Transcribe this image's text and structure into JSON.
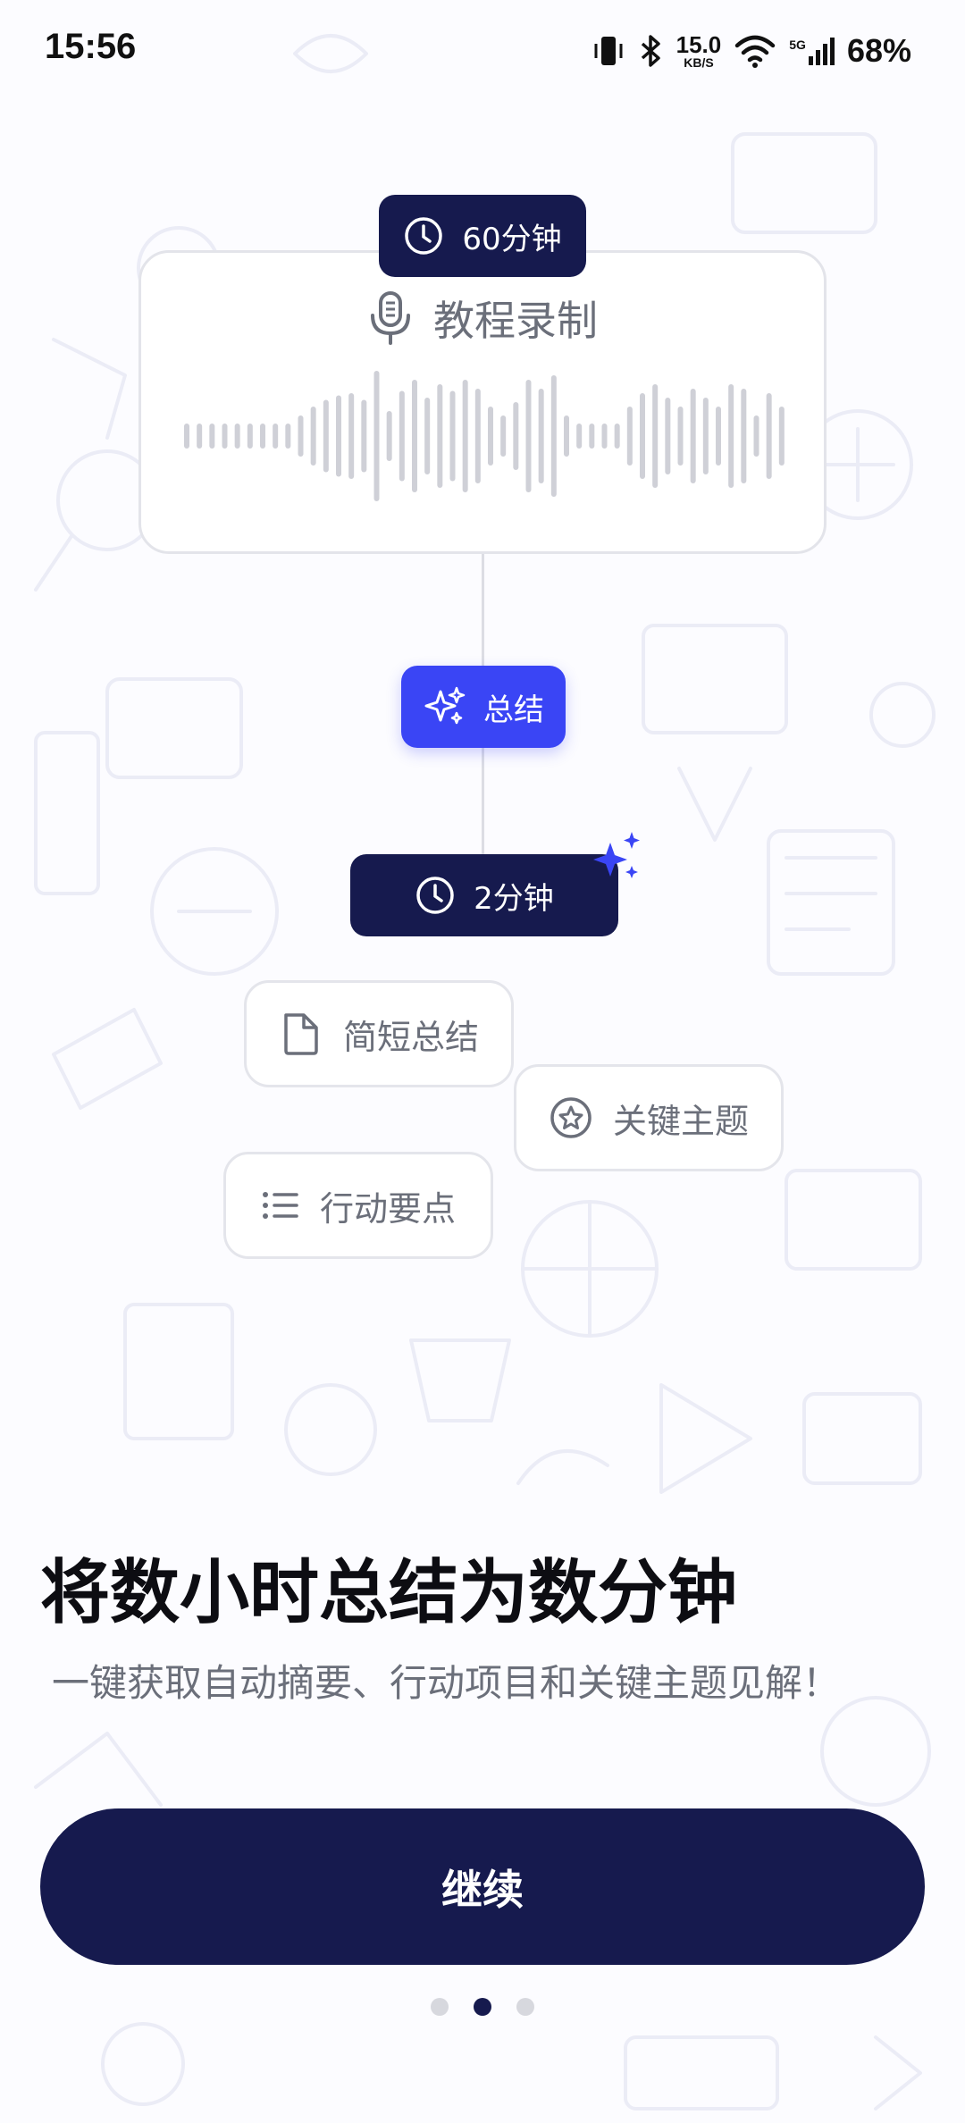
{
  "status_bar": {
    "time": "15:56",
    "net_speed_value": "15.0",
    "net_speed_unit": "KB/S",
    "network_type": "5G",
    "battery": "68%",
    "icons": [
      "vibrate-icon",
      "bluetooth-icon",
      "wifi-icon",
      "cellular-signal-icon"
    ]
  },
  "recording_card": {
    "duration_label": "60分钟",
    "title": "教程录制",
    "icons": [
      "clock-icon",
      "microphone-icon",
      "waveform-graphic"
    ]
  },
  "summary_step": {
    "label": "总结",
    "icon": "sparkle-icon"
  },
  "result_step": {
    "duration_label": "2分钟",
    "icon": "clock-icon"
  },
  "outputs": [
    {
      "label": "简短总结",
      "icon": "document-icon"
    },
    {
      "label": "关键主题",
      "icon": "star-badge-icon"
    },
    {
      "label": "行动要点",
      "icon": "list-icon"
    }
  ],
  "headline": "将数小时总结为数分钟",
  "subline": "一键获取自动摘要、行动项目和关键主题见解！",
  "continue_button": "继续",
  "pager": {
    "total": 3,
    "current": 2
  },
  "colors": {
    "navy": "#161a4e",
    "accent_blue": "#3a45f5",
    "muted_text": "#6b6f7a",
    "background": "#fcfcff"
  }
}
